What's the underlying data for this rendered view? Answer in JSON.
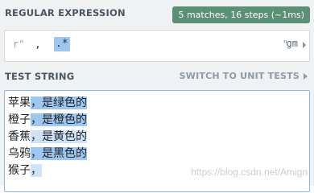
{
  "regex_section": {
    "title": "REGULAR EXPRESSION",
    "match_info": "5 matches, 16 steps (~1ms)",
    "delimiter_left": "r\"",
    "regex_prefix": ",",
    "regex_match": ".*",
    "delimiter_right": "\"",
    "flags": "gm"
  },
  "test_section": {
    "title": "TEST STRING",
    "switch_label": "SWITCH TO UNIT TESTS",
    "lines": [
      {
        "before": "苹果",
        "match": "，是绿色的"
      },
      {
        "before": "橙子",
        "match": "，是橙色的"
      },
      {
        "before": "香蕉",
        "match": "，是黄色的"
      },
      {
        "before": "乌鸦",
        "match": "，是黑色的"
      },
      {
        "before": "猴子",
        "match": "，"
      }
    ]
  },
  "watermark": "https://blog.csdn.net/Amign",
  "colors": {
    "badge": "#5b8f76",
    "match_highlight": "#9fc6ef",
    "match_highlight_alt": "#cfe2f7"
  }
}
